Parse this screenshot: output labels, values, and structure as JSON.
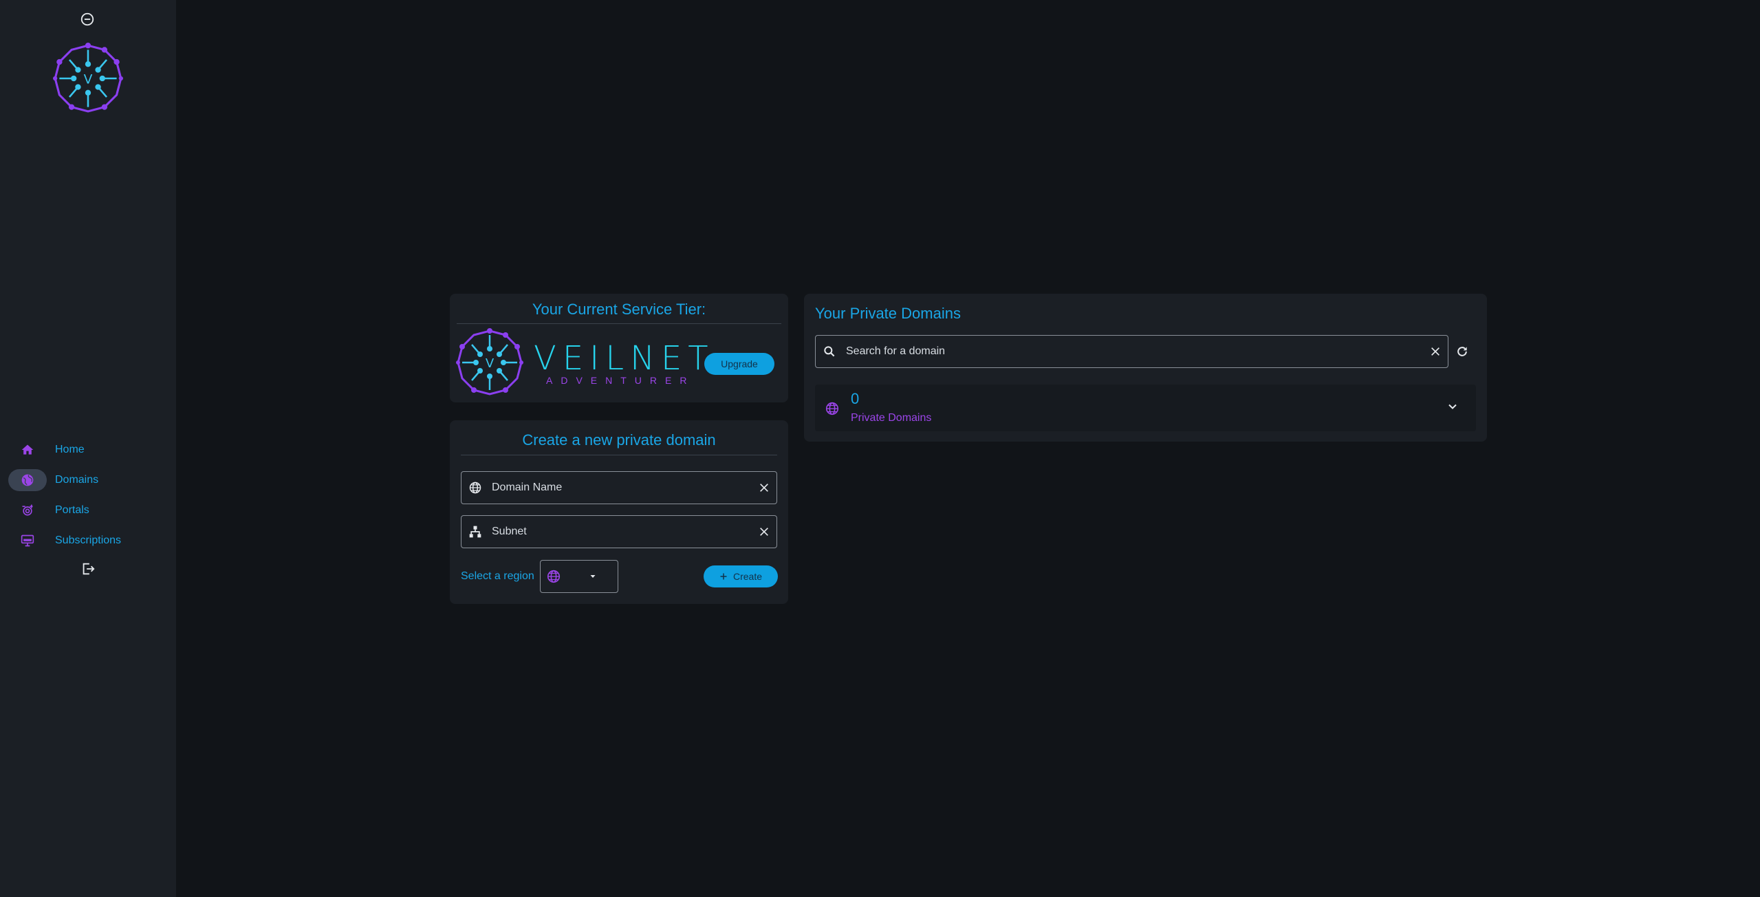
{
  "colors": {
    "accent": "#1aa6e6",
    "purple": "#9b45e8",
    "cyan": "#27d3ec",
    "background": "#111418",
    "panel": "#1b1f25"
  },
  "sidebar": {
    "collapse_icon": "minus-circle-icon",
    "logo_icon": "veilnet-logo-icon",
    "items": [
      {
        "label": "Home",
        "icon": "home-icon",
        "active": false
      },
      {
        "label": "Domains",
        "icon": "globe-icon",
        "active": true
      },
      {
        "label": "Portals",
        "icon": "portal-icon",
        "active": false
      },
      {
        "label": "Subscriptions",
        "icon": "monitor-icon",
        "active": false
      }
    ],
    "logout_icon": "logout-icon"
  },
  "tier": {
    "title": "Your Current Service Tier:",
    "brand": "VEILNET",
    "tier_name": "ADVENTURER",
    "upgrade_label": "Upgrade"
  },
  "create": {
    "title": "Create a new private domain",
    "domain_placeholder": "Domain Name",
    "subnet_placeholder": "Subnet",
    "region_label": "Select a region",
    "create_label": "Create"
  },
  "domains": {
    "title": "Your Private Domains",
    "search_placeholder": "Search for a domain",
    "count": "0",
    "count_label": "Private Domains"
  }
}
